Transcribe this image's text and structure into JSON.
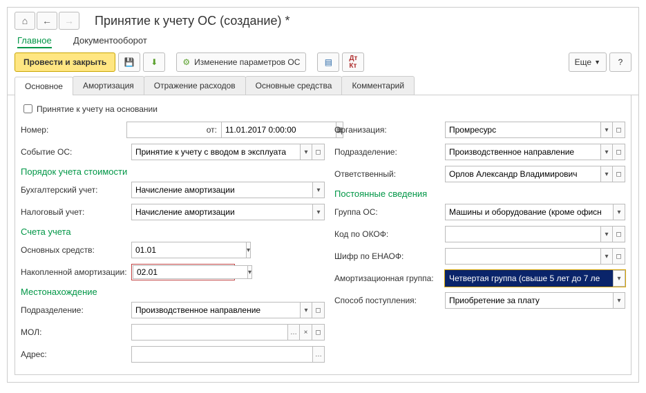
{
  "header": {
    "title": "Принятие к учету ОС (создание) *"
  },
  "viewtabs": {
    "tab1": "Главное",
    "tab2": "Документооборот"
  },
  "toolbar": {
    "submit": "Провести и закрыть",
    "change_params": "Изменение параметров ОС",
    "more": "Еще",
    "help": "?"
  },
  "doctabs": {
    "t1": "Основное",
    "t2": "Амортизация",
    "t3": "Отражение расходов",
    "t4": "Основные средства",
    "t5": "Комментарий"
  },
  "left": {
    "check_label": "Принятие к учету на основании",
    "num_label": "Номер:",
    "num_value": "",
    "ot_label": "от:",
    "date_value": "11.01.2017 0:00:00",
    "event_label": "Событие ОС:",
    "event_value": "Принятие к учету с вводом в эксплуата",
    "cost_head": "Порядок учета стоимости",
    "bu_label": "Бухгалтерский учет:",
    "bu_value": "Начисление амортизации",
    "nu_label": "Налоговый учет:",
    "nu_value": "Начисление амортизации",
    "acc_head": "Счета учета",
    "acc_os_label": "Основных средств:",
    "acc_os_value": "01.01",
    "acc_am_label": "Накопленной амортизации:",
    "acc_am_value": "02.01",
    "loc_head": "Местонахождение",
    "dept_label": "Подразделение:",
    "dept_value": "Производственное направление",
    "mol_label": "МОЛ:",
    "mol_value": "",
    "addr_label": "Адрес:",
    "addr_value": ""
  },
  "right": {
    "org_label": "Организация:",
    "org_value": "Промресурс",
    "dept_label": "Подразделение:",
    "dept_value": "Производственное направление",
    "resp_label": "Ответственный:",
    "resp_value": "Орлов Александр Владимирович",
    "perm_head": "Постоянные сведения",
    "group_label": "Группа ОС:",
    "group_value": "Машины и оборудование (кроме офисн",
    "okof_label": "Код по ОКОФ:",
    "okof_value": "",
    "enaof_label": "Шифр по ЕНАОФ:",
    "enaof_value": "",
    "amgroup_label": "Амортизационная группа:",
    "amgroup_value": "Четвертая группа (свыше 5 лет до 7 ле",
    "income_label": "Способ поступления:",
    "income_value": "Приобретение за плату"
  }
}
